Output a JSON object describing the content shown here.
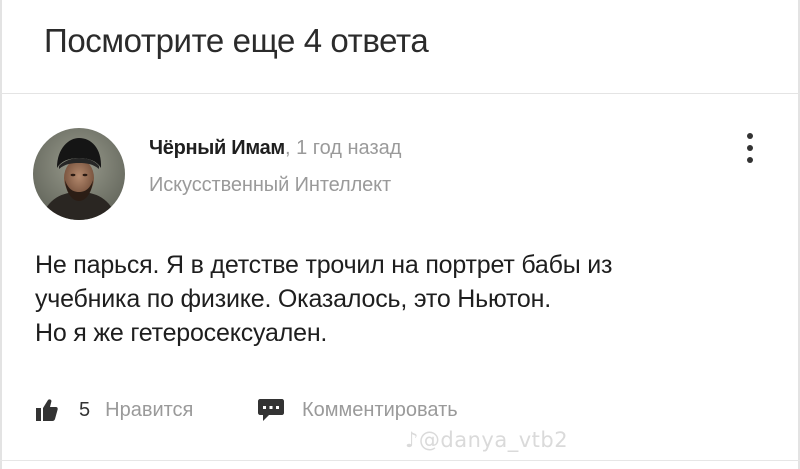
{
  "more_answers": {
    "label": "Посмотрите еще 4 ответа"
  },
  "answer": {
    "author": {
      "name": "Чёрный Имам",
      "separator": ",",
      "time": "1 год назад",
      "category": "Искусственный Интеллект",
      "avatar_icon": "user-avatar-photo"
    },
    "menu_icon": "more-vertical-icon",
    "text_lines": [
      "Не парься. Я в детстве трочил на портрет бабы из",
      "учебника по физике. Оказалось, это Ньютон.",
      "Но я же гетеросексуален."
    ],
    "actions": {
      "like_icon": "thumbs-up-icon",
      "likes": "5",
      "like_label": "Нравится",
      "comment_icon": "comment-icon",
      "comment_label": "Комментировать"
    }
  },
  "watermark": "♪@danya_vtb2",
  "colors": {
    "text_primary": "#1e1e1e",
    "text_secondary": "#9a9a9a",
    "divider": "#e4e4e4",
    "background": "#ffffff"
  }
}
